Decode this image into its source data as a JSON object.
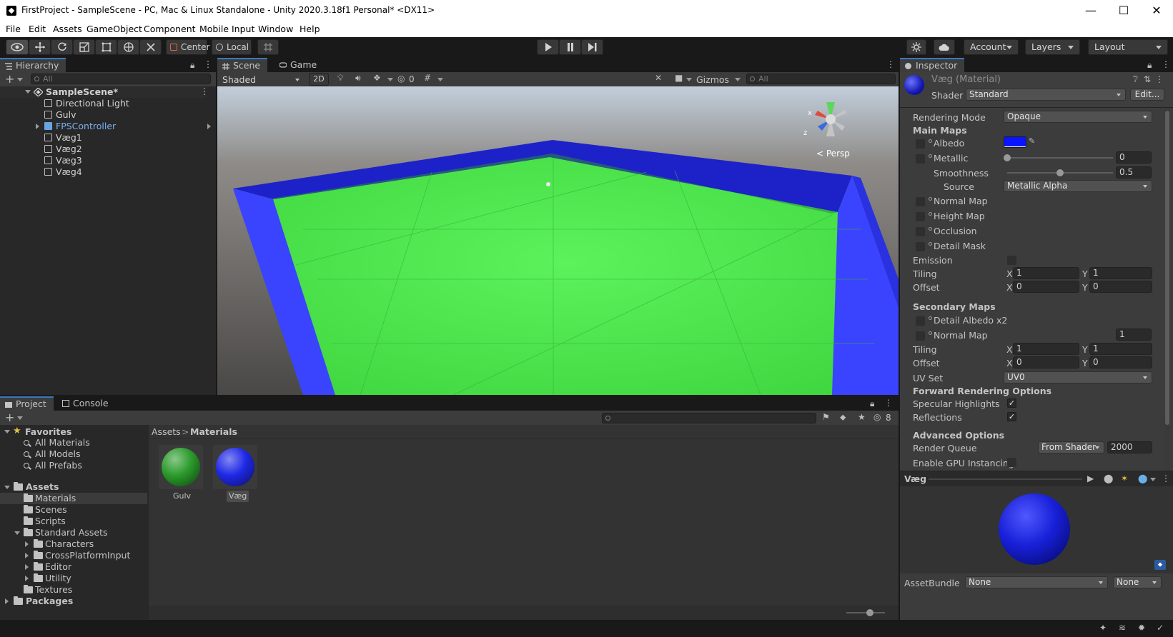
{
  "window": {
    "title": "FirstProject - SampleScene - PC, Mac & Linux Standalone - Unity 2020.3.18f1 Personal* <DX11>",
    "minimize": "—",
    "maximize": "☐",
    "close": "✕"
  },
  "menu": [
    "File",
    "Edit",
    "Assets",
    "GameObject",
    "Component",
    "Mobile Input",
    "Window",
    "Help"
  ],
  "toolbar": {
    "center_label": "Center",
    "local_label": "Local",
    "account_label": "Account",
    "layers_label": "Layers",
    "layout_label": "Layout"
  },
  "hierarchy": {
    "tab": "Hierarchy",
    "search_placeholder": "All",
    "scene": "SampleScene*",
    "items": [
      "Directional Light",
      "Gulv",
      "FPSController",
      "Væg1",
      "Væg2",
      "Væg3",
      "Væg4"
    ]
  },
  "scene_view": {
    "tab_scene": "Scene",
    "tab_game": "Game",
    "shading": "Shaded",
    "mode_2d": "2D",
    "hidden_count": "0",
    "gizmos": "Gizmos",
    "search_placeholder": "All",
    "persp": "Persp",
    "axis_x": "x",
    "axis_z": "z"
  },
  "inspector": {
    "tab": "Inspector",
    "material_name": "Væg (Material)",
    "shader_label": "Shader",
    "shader_value": "Standard",
    "edit_button": "Edit...",
    "rendering_mode_label": "Rendering Mode",
    "rendering_mode_value": "Opaque",
    "main_maps": "Main Maps",
    "albedo": "Albedo",
    "albedo_color": "#0a14ff",
    "metallic": "Metallic",
    "metallic_value": "0",
    "metallic_fraction": 0,
    "smoothness": "Smoothness",
    "smoothness_value": "0.5",
    "smoothness_fraction": 0.5,
    "source": "Source",
    "source_value": "Metallic Alpha",
    "normal_map": "Normal Map",
    "height_map": "Height Map",
    "occlusion": "Occlusion",
    "detail_mask": "Detail Mask",
    "emission": "Emission",
    "tiling": "Tiling",
    "offset": "Offset",
    "x": "X",
    "y": "Y",
    "main_tiling_x": "1",
    "main_tiling_y": "1",
    "main_offset_x": "0",
    "main_offset_y": "0",
    "secondary_maps": "Secondary Maps",
    "detail_albedo": "Detail Albedo x2",
    "sec_normal_map": "Normal Map",
    "sec_normal_value": "1",
    "sec_tiling_x": "1",
    "sec_tiling_y": "1",
    "sec_offset_x": "0",
    "sec_offset_y": "0",
    "uv_set": "UV Set",
    "uv_set_value": "UV0",
    "forward_options": "Forward Rendering Options",
    "specular_highlights": "Specular Highlights",
    "reflections": "Reflections",
    "check_mark": "✓",
    "advanced_options": "Advanced Options",
    "render_queue": "Render Queue",
    "render_queue_mode": "From Shader",
    "render_queue_value": "2000",
    "enable_gpu_instancing": "Enable GPU Instancing",
    "preview_name": "Væg",
    "assetbundle_label": "AssetBundle",
    "assetbundle_value": "None",
    "assetbundle_variant": "None"
  },
  "project": {
    "tab_project": "Project",
    "tab_console": "Console",
    "hidden_count": "8",
    "favorites": "Favorites",
    "fav_items": [
      "All Materials",
      "All Models",
      "All Prefabs"
    ],
    "assets": "Assets",
    "asset_folders": [
      "Materials",
      "Scenes",
      "Scripts"
    ],
    "standard_assets": "Standard Assets",
    "std_folders": [
      "Characters",
      "CrossPlatformInput",
      "Editor",
      "Utility"
    ],
    "textures": "Textures",
    "packages": "Packages",
    "breadcrumb_root": "Assets",
    "breadcrumb_sep": ">",
    "breadcrumb_current": "Materials",
    "materials": [
      {
        "name": "Gulv",
        "color": "#2a9a2a"
      },
      {
        "name": "Væg",
        "color": "#1e28e6"
      }
    ]
  }
}
